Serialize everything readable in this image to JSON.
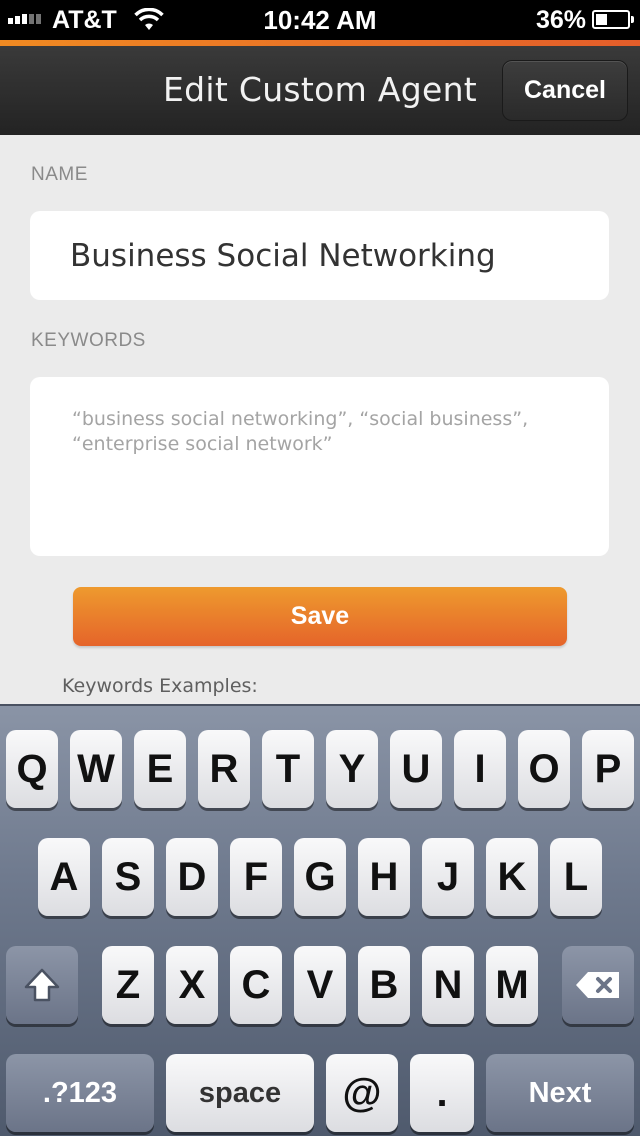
{
  "status_bar": {
    "carrier": "AT&T",
    "time": "10:42 AM",
    "battery": "36%",
    "battery_level": 0.36,
    "signal_icon": "signal-bars-icon",
    "wifi_icon": "wifi-icon",
    "battery_icon": "battery-icon"
  },
  "nav": {
    "title": "Edit Custom Agent",
    "cancel_label": "Cancel"
  },
  "form": {
    "name_label": "NAME",
    "name_value": "Business Social Networking",
    "keywords_label": "KEYWORDS",
    "keywords_placeholder": "“business social networking”, “social business”, “enterprise social network”",
    "save_label": "Save",
    "examples_label": "Keywords Examples:"
  },
  "keyboard": {
    "row1": [
      "Q",
      "W",
      "E",
      "R",
      "T",
      "Y",
      "U",
      "I",
      "O",
      "P"
    ],
    "row2": [
      "A",
      "S",
      "D",
      "F",
      "G",
      "H",
      "J",
      "K",
      "L"
    ],
    "row3": [
      "Z",
      "X",
      "C",
      "V",
      "B",
      "N",
      "M"
    ],
    "shift_icon": "shift-arrow-icon",
    "delete_icon": "backspace-icon",
    "numbers_label": ".?123",
    "space_label": "space",
    "at_label": "@",
    "dot_label": ".",
    "next_label": "Next"
  },
  "colors": {
    "accent_orange": "#e8772b",
    "nav_background": "#2e2e2e",
    "page_background": "#ebebeb"
  }
}
